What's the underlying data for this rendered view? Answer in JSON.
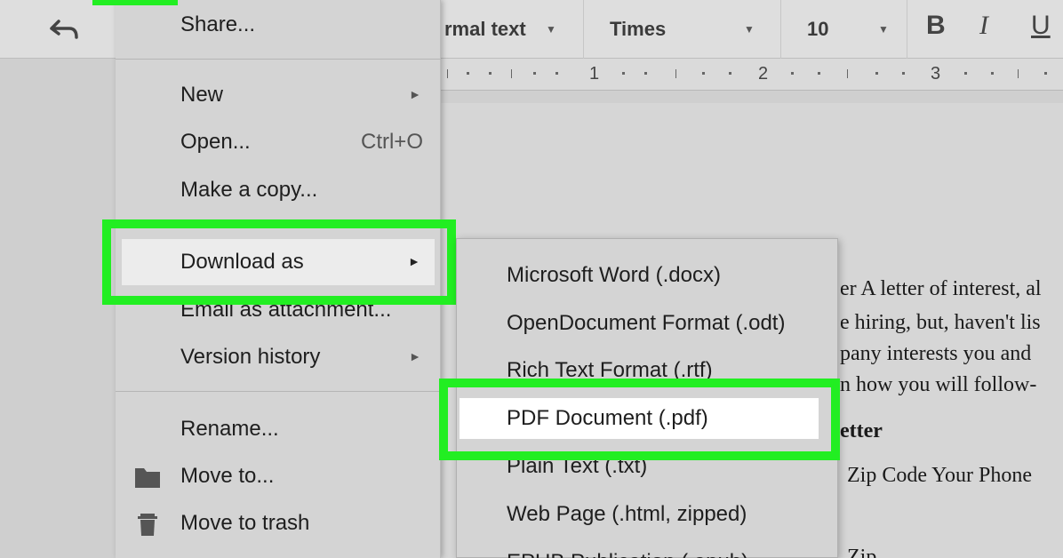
{
  "toolbar": {
    "style_value": "rmal text",
    "font_value": "Times",
    "size_value": "10",
    "bold_label": "B",
    "italic_label": "I",
    "underline_label": "U"
  },
  "ruler": {
    "marks": [
      "1",
      "2",
      "3"
    ]
  },
  "file_menu": {
    "items": [
      {
        "label": "Share..."
      },
      {
        "label": "New",
        "submenu": true
      },
      {
        "label": "Open...",
        "shortcut": "Ctrl+O"
      },
      {
        "label": "Make a copy..."
      },
      {
        "label": "Download as",
        "submenu": true,
        "highlighted": true
      },
      {
        "label": "Email as attachment..."
      },
      {
        "label": "Version history",
        "submenu": true
      },
      {
        "label": "Rename..."
      },
      {
        "label": "Move to...",
        "icon": "folder-icon"
      },
      {
        "label": "Move to trash",
        "icon": "trash-icon"
      }
    ],
    "arrow_glyph": "►"
  },
  "download_submenu": {
    "items": [
      {
        "label": "Microsoft Word (.docx)"
      },
      {
        "label": "OpenDocument Format (.odt)"
      },
      {
        "label": "Rich Text Format (.rtf)"
      },
      {
        "label": "PDF Document (.pdf)",
        "highlighted": true
      },
      {
        "label": "Plain Text (.txt)"
      },
      {
        "label": "Web Page (.html, zipped)"
      },
      {
        "label": "EPUB Publication (.epub)"
      }
    ]
  },
  "document": {
    "lines": [
      "er A letter of interest, al",
      "e hiring, but, haven't lis",
      "pany interests you and",
      "n how you will follow-",
      "etter",
      "Zip Code Your Phone",
      "Zip"
    ]
  },
  "colors": {
    "highlight_green": "#22ee22",
    "menu_bg": "#d4d4d4",
    "toolbar_bg": "#dedede"
  }
}
